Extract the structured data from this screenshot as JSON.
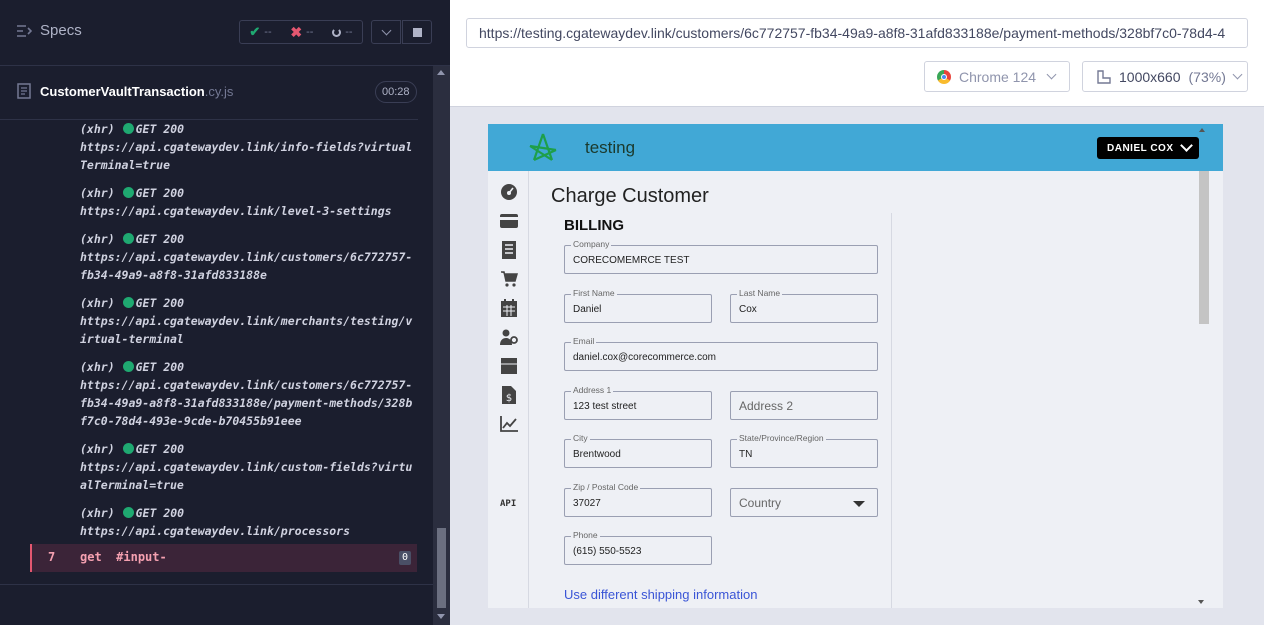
{
  "runner": {
    "specs_label": "Specs",
    "stats": {
      "passed": "--",
      "failed": "--",
      "pending": "--"
    },
    "spec_file": {
      "name": "CustomerVaultTransaction",
      "ext": ".cy.js",
      "duration": "00:28"
    },
    "log": [
      {
        "type": "(xhr)",
        "request": "GET 200",
        "url": "https://api.cgatewaydev.link/info-fields?virtualTerminal=true"
      },
      {
        "type": "(xhr)",
        "request": "GET 200",
        "url": "https://api.cgatewaydev.link/level-3-settings"
      },
      {
        "type": "(xhr)",
        "request": "GET 200",
        "url": "https://api.cgatewaydev.link/customers/6c772757-fb34-49a9-a8f8-31afd833188e"
      },
      {
        "type": "(xhr)",
        "request": "GET 200",
        "url": "https://api.cgatewaydev.link/merchants/testing/virtual-terminal"
      },
      {
        "type": "(xhr)",
        "request": "GET 200",
        "url": "https://api.cgatewaydev.link/customers/6c772757-fb34-49a9-a8f8-31afd833188e/payment-methods/328bf7c0-78d4-493e-9cde-b70455b91eee"
      },
      {
        "type": "(xhr)",
        "request": "GET 200",
        "url": "https://api.cgatewaydev.link/custom-fields?virtualTerminal=true"
      },
      {
        "type": "(xhr)",
        "request": "GET 200",
        "url": "https://api.cgatewaydev.link/processors"
      }
    ],
    "current_command": {
      "number": "7",
      "command": "get",
      "selector": "#input-",
      "count": "0"
    }
  },
  "aut": {
    "url": "https://testing.cgatewaydev.link/customers/6c772757-fb34-49a9-a8f8-31afd833188e/payment-methods/328bf7c0-78d4-4",
    "browser": "Chrome 124",
    "viewport": "1000x660",
    "scale": "(73%)"
  },
  "app": {
    "brand": "testing",
    "user_name": "DANIEL COX",
    "nav_api_label": "API",
    "page_title": "Charge Customer",
    "section_title": "BILLING",
    "fields": {
      "company": {
        "label": "Company",
        "value": "CORECOMEMRCE TEST"
      },
      "first_name": {
        "label": "First Name",
        "value": "Daniel"
      },
      "last_name": {
        "label": "Last Name",
        "value": "Cox"
      },
      "email": {
        "label": "Email",
        "value": "daniel.cox@corecommerce.com"
      },
      "address1": {
        "label": "Address 1",
        "value": "123 test street"
      },
      "address2": {
        "placeholder": "Address 2"
      },
      "city": {
        "label": "City",
        "value": "Brentwood"
      },
      "state": {
        "label": "State/Province/Region",
        "value": "TN"
      },
      "zip": {
        "label": "Zip / Postal Code",
        "value": "37027"
      },
      "country": {
        "placeholder": "Country"
      },
      "phone": {
        "label": "Phone",
        "value": "(615) 550-5523"
      }
    },
    "shipping_link": "Use different shipping information"
  },
  "colors": {
    "runner_bg": "#1b1e2e",
    "header_blue": "#41a8d6",
    "success_dot": "#1fa971",
    "link_blue": "#3a55d6",
    "command_highlight": "#3b2438"
  }
}
